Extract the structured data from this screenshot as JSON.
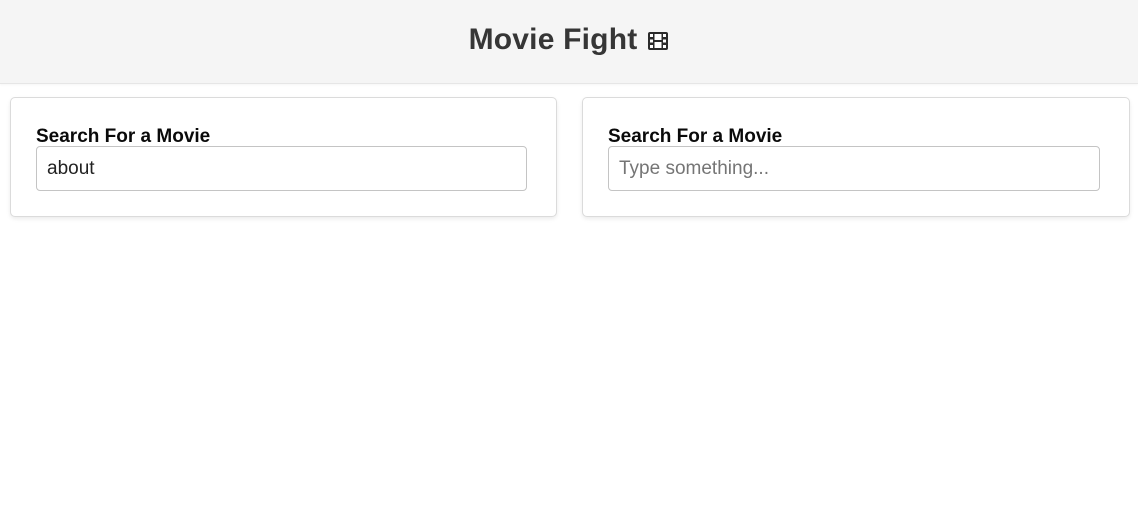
{
  "header": {
    "title": "Movie Fight",
    "icon": "film-icon"
  },
  "left_panel": {
    "label": "Search For a Movie",
    "input_value": "about",
    "placeholder": "Type something..."
  },
  "right_panel": {
    "label": "Search For a Movie",
    "input_value": "",
    "placeholder": "Type something..."
  },
  "colors": {
    "header_bg": "#f5f5f5",
    "title_text": "#363636",
    "card_border": "#dbdbdb"
  }
}
